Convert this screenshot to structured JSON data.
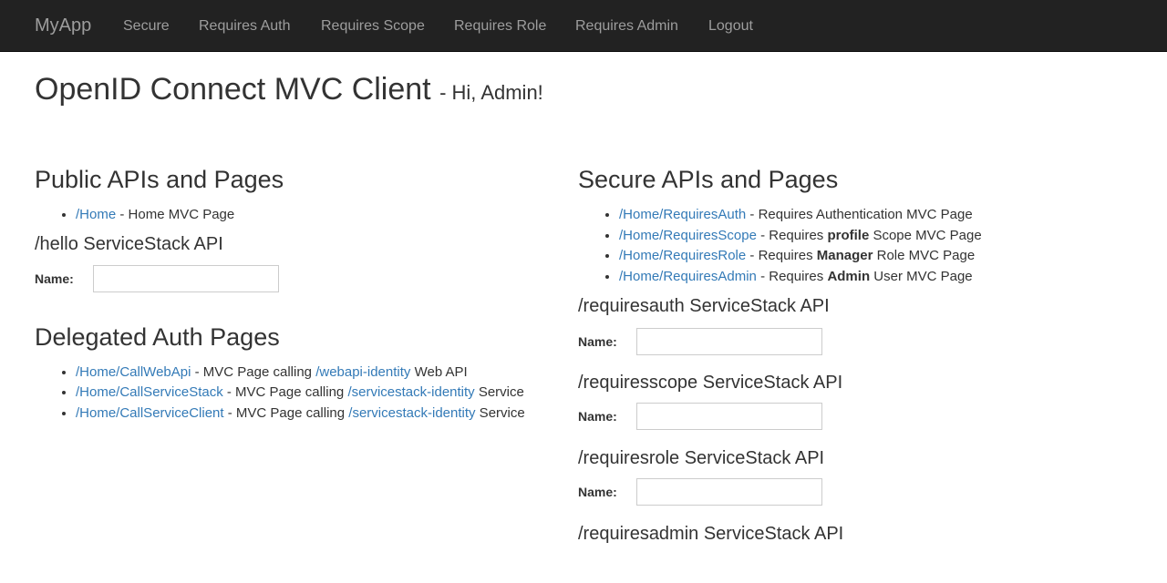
{
  "navbar": {
    "brand": "MyApp",
    "items": [
      {
        "label": "Secure"
      },
      {
        "label": "Requires Auth"
      },
      {
        "label": "Requires Scope"
      },
      {
        "label": "Requires Role"
      },
      {
        "label": "Requires Admin"
      },
      {
        "label": "Logout"
      }
    ]
  },
  "header": {
    "title": "OpenID Connect MVC Client",
    "greeting": "- Hi, Admin!"
  },
  "public_section": {
    "title": "Public APIs and Pages",
    "links": [
      {
        "link": "/Home",
        "text": " - Home MVC Page"
      }
    ],
    "api": {
      "title": "/hello ServiceStack API",
      "name_label": "Name:",
      "name_value": ""
    }
  },
  "delegated_section": {
    "title": "Delegated Auth Pages",
    "links": [
      {
        "link": "/Home/CallWebApi",
        "mid": " - MVC Page calling ",
        "link2": "/webapi-identity",
        "tail": " Web API"
      },
      {
        "link": "/Home/CallServiceStack",
        "mid": " - MVC Page calling ",
        "link2": "/servicestack-identity",
        "tail": " Service"
      },
      {
        "link": "/Home/CallServiceClient",
        "mid": " - MVC Page calling ",
        "link2": "/servicestack-identity",
        "tail": " Service"
      }
    ]
  },
  "secure_section": {
    "title": "Secure APIs and Pages",
    "links": [
      {
        "link": "/Home/RequiresAuth",
        "pre": " - Requires Authentication MVC Page",
        "bold": "",
        "post": ""
      },
      {
        "link": "/Home/RequiresScope",
        "pre": " - Requires ",
        "bold": "profile",
        "post": " Scope MVC Page"
      },
      {
        "link": "/Home/RequiresRole",
        "pre": " - Requires ",
        "bold": "Manager",
        "post": " Role MVC Page"
      },
      {
        "link": "/Home/RequiresAdmin",
        "pre": " - Requires ",
        "bold": "Admin",
        "post": " User MVC Page"
      }
    ],
    "apis": [
      {
        "title": "/requiresauth ServiceStack API",
        "name_label": "Name:",
        "name_value": ""
      },
      {
        "title": "/requiresscope ServiceStack API",
        "name_label": "Name:",
        "name_value": ""
      },
      {
        "title": "/requiresrole ServiceStack API",
        "name_label": "Name:",
        "name_value": ""
      },
      {
        "title": "/requiresadmin ServiceStack API"
      }
    ]
  }
}
